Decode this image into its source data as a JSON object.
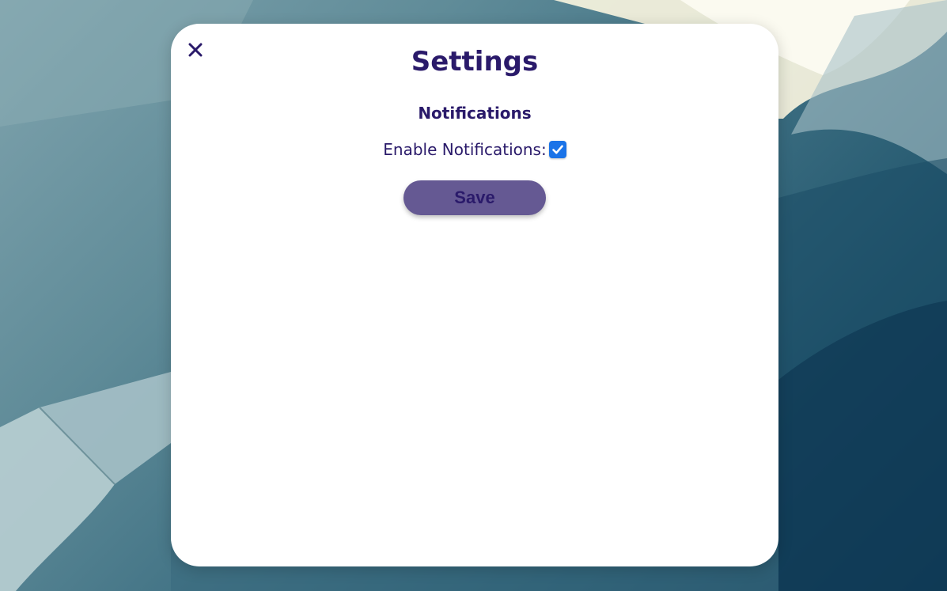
{
  "dialog": {
    "title": "Settings",
    "close_icon": "close-icon",
    "section_heading": "Notifications",
    "enable_notifications": {
      "label": "Enable Notifications:",
      "checked": true
    },
    "save_label": "Save"
  },
  "colors": {
    "text": "#2a1a6a",
    "button_bg": "#655993",
    "checkbox_bg": "#1a73e8",
    "panel_bg": "#ffffff"
  }
}
